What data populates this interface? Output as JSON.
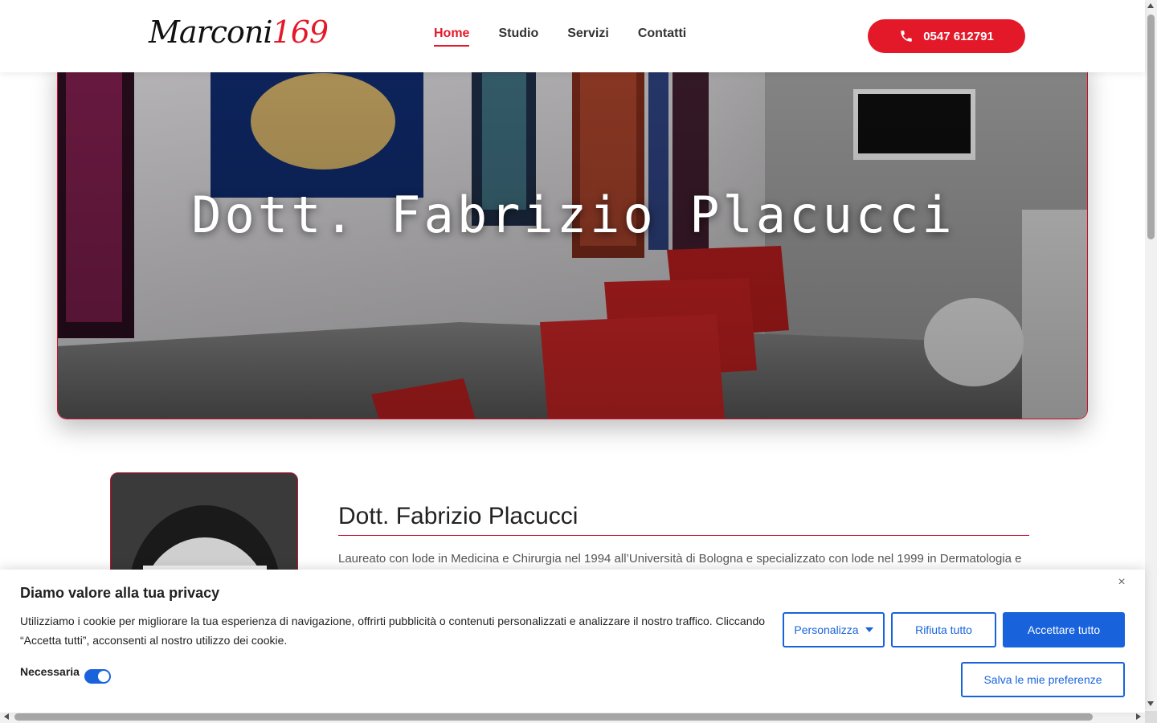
{
  "header": {
    "logo_text": "Marconi",
    "logo_number": "169",
    "nav": [
      {
        "label": "Home",
        "active": true
      },
      {
        "label": "Studio",
        "active": false
      },
      {
        "label": "Servizi",
        "active": false
      },
      {
        "label": "Contatti",
        "active": false
      }
    ],
    "phone_label": "0547 612791",
    "phone_icon": "phone-icon"
  },
  "hero": {
    "title": "Dott. Fabrizio Placucci"
  },
  "profile": {
    "name": "Dott. Fabrizio Placucci",
    "bio": "Laureato con lode in Medicina e Chirurgia nel 1994 all’Università di Bologna e specializzato con lode nel 1999 in Dermatologia e"
  },
  "cookie_banner": {
    "title": "Diamo valore alla tua privacy",
    "text": "Utilizziamo i cookie per migliorare la tua esperienza di navigazione, offrirti pubblicità o contenuti personalizzati e analizzare il nostro traffico. Cliccando “Accetta tutti”, acconsenti al nostro utilizzo dei cookie.",
    "necessary_label": "Necessaria",
    "necessary_enabled": true,
    "customize_label": "Personalizza",
    "reject_label": "Rifiuta tutto",
    "accept_label": "Accettare tutto",
    "save_label": "Salva le mie preferenze",
    "close_symbol": "×"
  },
  "colors": {
    "brand_red": "#e3192a",
    "cookie_blue": "#1863dc"
  }
}
